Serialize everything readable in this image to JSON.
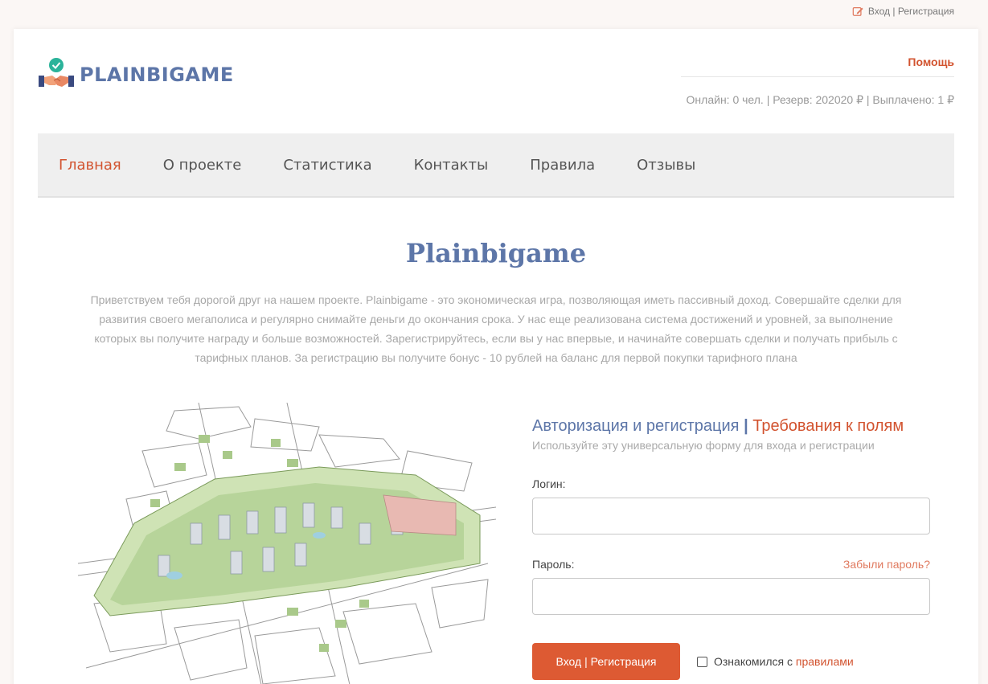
{
  "topbar": {
    "auth_link": "Вход | Регистрация"
  },
  "header": {
    "brand": "PLAINBIGAME",
    "help": "Помощь",
    "stats": "Онлайн: 0 чел. | Резерв: 202020 ₽ | Выплачено: 1 ₽"
  },
  "nav": {
    "items": [
      {
        "label": "Главная"
      },
      {
        "label": "О проекте"
      },
      {
        "label": "Статистика"
      },
      {
        "label": "Контакты"
      },
      {
        "label": "Правила"
      },
      {
        "label": "Отзывы"
      }
    ]
  },
  "main": {
    "title": "Plainbigame",
    "intro": "Приветствуем тебя дорогой друг на нашем проекте. Plainbigame - это экономическая игра, позволяющая иметь пассивный доход. Совершайте сделки для развития своего мегаполиса и регулярно снимайте деньги до окончания срока. У нас еще реализована система достижений и уровней, за выполнение которых вы получите награду и больше возможностей. Зарегистрируйтесь, если вы у нас впервые, и начинайте совершать сделки и получать прибыль с тарифных планов. За регистрацию вы получите бонус - 10 рублей на баланс для первой покупки тарифного плана"
  },
  "form": {
    "heading_auth": "Авторизация и регистрация",
    "heading_sep": "|",
    "heading_req": "Требования к полям",
    "subtitle": "Используйте эту универсальную форму для входа и регистрации",
    "login_label": "Логин:",
    "login_value": "",
    "password_label": "Пароль:",
    "password_value": "",
    "forgot": "Забыли пароль?",
    "submit": "Вход | Регистрация",
    "agree_prefix": "Ознакомился с ",
    "agree_link": "правилами"
  },
  "colors": {
    "accent": "#d2532f",
    "brand": "#5d76a8"
  }
}
